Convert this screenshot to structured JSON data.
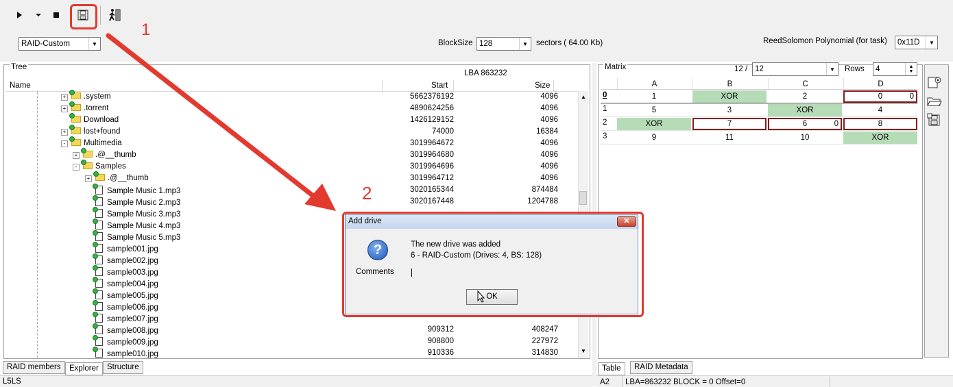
{
  "toolbar": {
    "play_icon": "play-icon",
    "dropdown_icon": "chevron-down-icon",
    "stop_icon": "stop-icon",
    "save_icon": "save-icon",
    "exit_icon": "exit-icon"
  },
  "top": {
    "raid_type": "RAID-Custom",
    "blocksize_label": "BlockSize",
    "blocksize_value": "128",
    "blocksize_unit": "sectors ( 64.00 Kb)",
    "rs_label": "ReedSolomon Polynomial (for task)",
    "rs_value": "0x11D"
  },
  "tree": {
    "title": "Tree",
    "lba": "LBA  863232",
    "col_name": "Name",
    "col_start": "Start",
    "col_size": "Size",
    "rows": [
      {
        "name": ".system",
        "start": "5662376192",
        "size": "4096",
        "type": "folder",
        "indent": 80,
        "pm": "+"
      },
      {
        "name": ".torrent",
        "start": "4890624256",
        "size": "4096",
        "type": "folder",
        "indent": 80,
        "pm": "+"
      },
      {
        "name": "Download",
        "start": "1426129152",
        "size": "4096",
        "type": "folder",
        "indent": 80,
        "pm": ""
      },
      {
        "name": "lost+found",
        "start": "74000",
        "size": "16384",
        "type": "folder",
        "indent": 80,
        "pm": "+"
      },
      {
        "name": "Multimedia",
        "start": "3019964672",
        "size": "4096",
        "type": "folder",
        "indent": 80,
        "pm": "-"
      },
      {
        "name": ".@__thumb",
        "start": "3019964680",
        "size": "4096",
        "type": "folder",
        "indent": 97,
        "pm": "+"
      },
      {
        "name": "Samples",
        "start": "3019964696",
        "size": "4096",
        "type": "folder",
        "indent": 97,
        "pm": "-"
      },
      {
        "name": ".@__thumb",
        "start": "3019964712",
        "size": "4096",
        "type": "folder",
        "indent": 115,
        "pm": "+"
      },
      {
        "name": "Sample Music 1.mp3",
        "start": "3020165344",
        "size": "874484",
        "type": "file",
        "indent": 130,
        "pm": ""
      },
      {
        "name": "Sample Music 2.mp3",
        "start": "3020167448",
        "size": "1204788",
        "type": "file",
        "indent": 130,
        "pm": ""
      },
      {
        "name": "Sample Music 3.mp3",
        "start": "",
        "size": "",
        "type": "file",
        "indent": 130,
        "pm": ""
      },
      {
        "name": "Sample Music 4.mp3",
        "start": "",
        "size": "",
        "type": "file",
        "indent": 130,
        "pm": ""
      },
      {
        "name": "Sample Music 5.mp3",
        "start": "",
        "size": "",
        "type": "file",
        "indent": 130,
        "pm": ""
      },
      {
        "name": "sample001.jpg",
        "start": "",
        "size": "",
        "type": "file",
        "indent": 130,
        "pm": ""
      },
      {
        "name": "sample002.jpg",
        "start": "",
        "size": "",
        "type": "file",
        "indent": 130,
        "pm": ""
      },
      {
        "name": "sample003.jpg",
        "start": "",
        "size": "",
        "type": "file",
        "indent": 130,
        "pm": ""
      },
      {
        "name": "sample004.jpg",
        "start": "",
        "size": "",
        "type": "file",
        "indent": 130,
        "pm": ""
      },
      {
        "name": "sample005.jpg",
        "start": "",
        "size": "",
        "type": "file",
        "indent": 130,
        "pm": ""
      },
      {
        "name": "sample006.jpg",
        "start": "",
        "size": "",
        "type": "file",
        "indent": 130,
        "pm": ""
      },
      {
        "name": "sample007.jpg",
        "start": "",
        "size": "",
        "type": "file",
        "indent": 130,
        "pm": ""
      },
      {
        "name": "sample008.jpg",
        "start": "909312",
        "size": "408247",
        "type": "file",
        "indent": 130,
        "pm": ""
      },
      {
        "name": "sample009.jpg",
        "start": "908800",
        "size": "227972",
        "type": "file",
        "indent": 130,
        "pm": ""
      },
      {
        "name": "sample010.jpg",
        "start": "910336",
        "size": "314830",
        "type": "file",
        "indent": 130,
        "pm": ""
      }
    ]
  },
  "left_tabs": [
    "RAID members",
    "Explorer",
    "Structure"
  ],
  "left_status": "L5LS",
  "matrix": {
    "title": "Matrix",
    "page_prefix": "12 /",
    "page_value": "12",
    "rows_label": "Rows",
    "rows_value": "4",
    "columns": [
      "A",
      "B",
      "C",
      "D"
    ],
    "row_labels": [
      "0",
      "1",
      "2",
      "3"
    ],
    "cells": [
      [
        {
          "t": "1",
          "k": ""
        },
        {
          "t": "XOR",
          "k": "xor"
        },
        {
          "t": "2",
          "k": ""
        },
        {
          "t": "0",
          "k": "red",
          "off": "0"
        }
      ],
      [
        {
          "t": "5",
          "k": ""
        },
        {
          "t": "3",
          "k": ""
        },
        {
          "t": "XOR",
          "k": "xor"
        },
        {
          "t": "4",
          "k": ""
        }
      ],
      [
        {
          "t": "XOR",
          "k": "xor"
        },
        {
          "t": "7",
          "k": "red",
          "off": ""
        },
        {
          "t": "6",
          "k": "red",
          "off": "0"
        },
        {
          "t": "8",
          "k": "red",
          "off": ""
        }
      ],
      [
        {
          "t": "9",
          "k": ""
        },
        {
          "t": "11",
          "k": ""
        },
        {
          "t": "10",
          "k": ""
        },
        {
          "t": "XOR",
          "k": "xor"
        }
      ]
    ]
  },
  "right_tabs": [
    "Table",
    "RAID Metadata"
  ],
  "right_status": {
    "cell": "A2",
    "info": "LBA=863232 BLOCK = 0 Offset=0"
  },
  "dialog": {
    "title": "Add drive",
    "line1": "The new drive was added",
    "line2": "6 - RAID-Custom (Drives: 4, BS: 128)",
    "comments_label": "Comments",
    "ok_label": "OK",
    "icon": "question-icon"
  },
  "annotations": {
    "label1": "1",
    "label2": "2",
    "color": "#e23a2e"
  }
}
